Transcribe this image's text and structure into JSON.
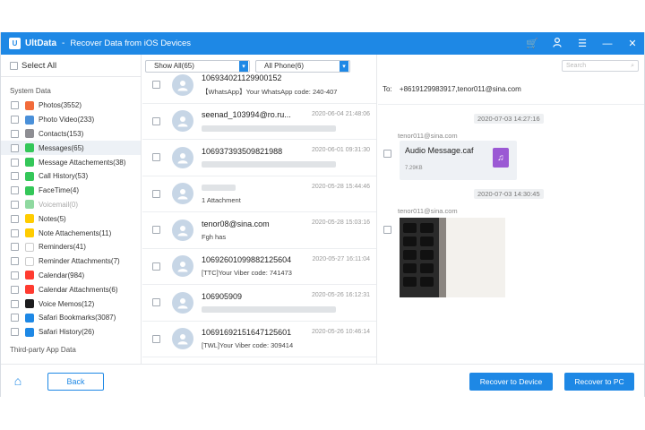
{
  "window": {
    "app_name": "UltData",
    "subtitle": "Recover Data from iOS Devices",
    "separator": "-",
    "accent": "#1e88e5"
  },
  "sidebar": {
    "select_all": "Select All",
    "system_heading": "System Data",
    "items": [
      {
        "label": "Photos(3552)",
        "icon": "photos-icon",
        "color": "#f26b3a"
      },
      {
        "label": "Photo Video(233)",
        "icon": "video-icon",
        "color": "#4a90d9"
      },
      {
        "label": "Contacts(153)",
        "icon": "contacts-icon",
        "color": "#8e8e93"
      },
      {
        "label": "Messages(65)",
        "icon": "messages-icon",
        "color": "#34c759"
      },
      {
        "label": "Message Attachements(38)",
        "icon": "message-attachment-icon",
        "color": "#34c759"
      },
      {
        "label": "Call History(53)",
        "icon": "phone-icon",
        "color": "#34c759"
      },
      {
        "label": "FaceTime(4)",
        "icon": "facetime-icon",
        "color": "#34c759"
      },
      {
        "label": "Voicemail(0)",
        "icon": "voicemail-icon",
        "color": "#8fd9a0"
      },
      {
        "label": "Notes(5)",
        "icon": "notes-icon",
        "color": "#ffcc00"
      },
      {
        "label": "Note Attachements(11)",
        "icon": "note-attachment-icon",
        "color": "#ffcc00"
      },
      {
        "label": "Reminders(41)",
        "icon": "reminders-icon",
        "color": "#ffffff"
      },
      {
        "label": "Reminder Attachments(7)",
        "icon": "reminder-attachment-icon",
        "color": "#ffffff"
      },
      {
        "label": "Calendar(984)",
        "icon": "calendar-icon",
        "color": "#ff3b30"
      },
      {
        "label": "Calendar Attachments(6)",
        "icon": "calendar-attachment-icon",
        "color": "#ff3b30"
      },
      {
        "label": "Voice Memos(12)",
        "icon": "voice-memos-icon",
        "color": "#1c1c1e"
      },
      {
        "label": "Safari Bookmarks(3087)",
        "icon": "safari-icon",
        "color": "#1e88e5"
      },
      {
        "label": "Safari History(26)",
        "icon": "safari-history-icon",
        "color": "#1e88e5"
      }
    ],
    "third_party_heading": "Third-party App Data"
  },
  "filters": {
    "show": "Show All(65)",
    "phone": "All Phone(6)"
  },
  "messages": [
    {
      "name": "106934021129900152",
      "date": "",
      "preview": "【WhatsApp】Your WhatsApp code: 240-407"
    },
    {
      "name": "seenad_103994@ro.ru...",
      "date": "2020-06-04 21:48:06",
      "preview": ""
    },
    {
      "name": "106937393509821988",
      "date": "2020-06-01 09:31:30",
      "preview": ""
    },
    {
      "name": "",
      "date": "2020-05-28 15:44:46",
      "preview": "1 Attachment"
    },
    {
      "name": "tenor08@sina.com",
      "date": "2020-05-28 15:03:16",
      "preview": "Fgh has"
    },
    {
      "name": "10692601099882125604",
      "date": "2020-05-27 16:11:04",
      "preview": "[TTC]Your Viber code: 741473"
    },
    {
      "name": "106905909",
      "date": "2020-05-26 16:12:31",
      "preview": ""
    },
    {
      "name": "10691692151647125601",
      "date": "2020-05-26 10:46:14",
      "preview": "[TWL]Your Viber code: 309414"
    }
  ],
  "detail": {
    "search_placeholder": "Search",
    "to_label": "To:",
    "to_value": "+8619129983917,tenor011@sina.com",
    "time1": "2020-07-03 14:27:16",
    "sender1": "tenor011@sina.com",
    "attachment_name": "Audio Message.caf",
    "attachment_size": "7.29KB",
    "time2": "2020-07-03 14:30:45",
    "sender2": "tenor011@sina.com"
  },
  "bottom": {
    "back": "Back",
    "recover_device": "Recover to Device",
    "recover_pc": "Recover to PC"
  }
}
